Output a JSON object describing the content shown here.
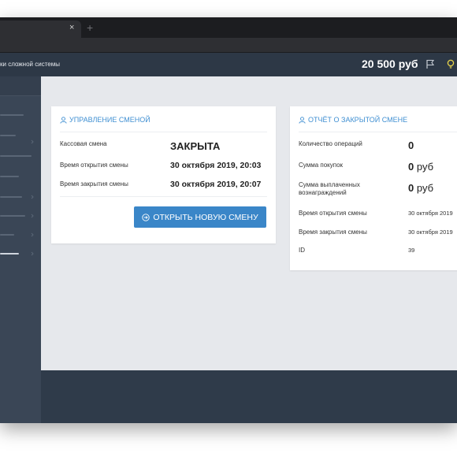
{
  "browser": {
    "tab_close": "×",
    "new_tab": "+"
  },
  "header": {
    "title": "ки сложной системы",
    "balance": "20 500 руб",
    "flag_icon": "flag-icon",
    "bulb_icon": "bulb-icon"
  },
  "shift_management": {
    "title": "УПРАВЛЕНИЕ СМЕНОЙ",
    "rows": [
      {
        "label": "Кассовая смена",
        "value": "ЗАКРЫТА"
      },
      {
        "label": "Время открытия смены",
        "value": "30 октября 2019, 20:03"
      },
      {
        "label": "Время закрытия смены",
        "value": "30 октября 2019, 20:07"
      }
    ],
    "open_button": "ОТКРЫТЬ НОВУЮ СМЕНУ"
  },
  "closed_shift_report": {
    "title": "ОТЧЁТ О ЗАКРЫТОЙ СМЕНЕ",
    "rows": [
      {
        "label": "Количество операций",
        "value": "0",
        "unit": ""
      },
      {
        "label": "Сумма покупок",
        "value": "0",
        "unit": "руб"
      },
      {
        "label": "Сумма выплаченных вознаграждений",
        "value": "0",
        "unit": "руб"
      },
      {
        "label": "Время открытия смены",
        "value": "30 октября 2019"
      },
      {
        "label": "Время закрытия смены",
        "value": "30 октября 2019"
      },
      {
        "label": "ID",
        "value": "39"
      }
    ]
  },
  "colors": {
    "accent": "#3f8fd2",
    "button": "#3a86c8",
    "header_bg": "#2d3846",
    "sidebar_bg": "#3a4656",
    "content_bg": "#e6e8ec",
    "bulb": "#e8d44a"
  }
}
